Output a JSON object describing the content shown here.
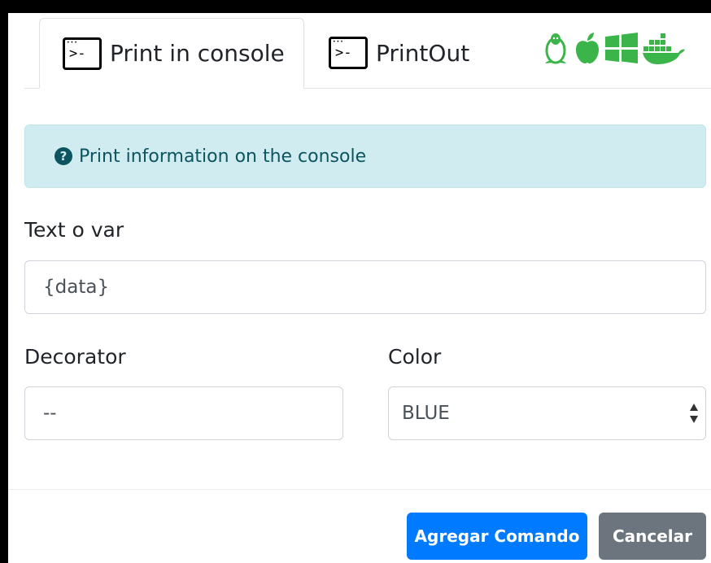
{
  "tabs": [
    {
      "label": "Print in console",
      "icon": "terminal-icon",
      "active": true
    },
    {
      "label": "PrintOut",
      "icon": "terminal-icon",
      "active": false
    }
  ],
  "os_icons": [
    "linux-icon",
    "apple-icon",
    "windows-icon",
    "docker-icon"
  ],
  "colors": {
    "os_icon": "#3bb54a",
    "info_bg": "#d1ecf1",
    "info_text": "#0c5460",
    "primary": "#007bff",
    "secondary": "#6c757d"
  },
  "info": {
    "icon": "question-circle-icon",
    "text": "Print information on the console"
  },
  "form": {
    "text_var": {
      "label": "Text o var",
      "value": "{data}"
    },
    "decorator": {
      "label": "Decorator",
      "value": "--"
    },
    "color": {
      "label": "Color",
      "selected": "BLUE"
    }
  },
  "buttons": {
    "add": "Agregar Comando",
    "cancel": "Cancelar"
  }
}
